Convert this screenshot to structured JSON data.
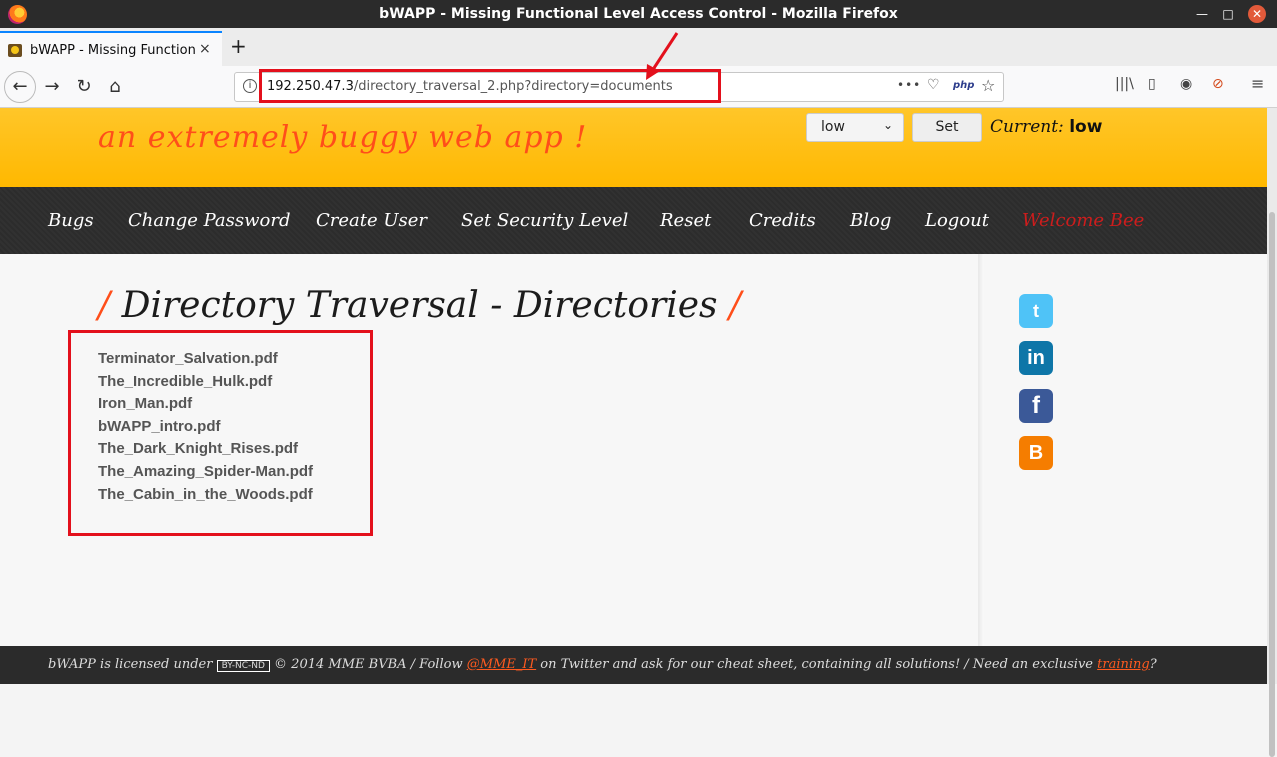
{
  "window": {
    "title": "bWAPP - Missing Functional Level Access Control - Mozilla Firefox"
  },
  "tab": {
    "title": "bWAPP - Missing Function",
    "close": "×",
    "new_tab": "+"
  },
  "nav": {
    "back": "←",
    "forward": "→",
    "reload": "↻",
    "home": "⌂"
  },
  "urlbar": {
    "info": "i",
    "host": "192.250.47.3",
    "path": "/directory_traversal_2.php?directory=documents",
    "more": "•••",
    "pocket": "♡",
    "php": "php",
    "bookmark": "☆"
  },
  "toolbar": {
    "library": "|||\\",
    "sidebar": "▯",
    "account": "◉",
    "addon": "⊘",
    "menu": "≡"
  },
  "header": {
    "tagline": "an extremely buggy web app !",
    "security_level": "low",
    "set_label": "Set",
    "current_label": "Current:",
    "current_value": "low"
  },
  "menu": {
    "items": [
      "Bugs",
      "Change Password",
      "Create User",
      "Set Security Level",
      "Reset",
      "Credits",
      "Blog",
      "Logout"
    ],
    "welcome": "Welcome Bee"
  },
  "main": {
    "slash": "/",
    "heading": "Directory Traversal - Directories",
    "files": [
      "Terminator_Salvation.pdf",
      "The_Incredible_Hulk.pdf",
      "Iron_Man.pdf",
      "bWAPP_intro.pdf",
      "The_Dark_Knight_Rises.pdf",
      "The_Amazing_Spider-Man.pdf",
      "The_Cabin_in_the_Woods.pdf"
    ]
  },
  "social": {
    "twitter": "t",
    "linkedin": "in",
    "facebook": "f",
    "blogger": "B"
  },
  "footer": {
    "part1": "bWAPP is licensed under",
    "cc": "BY-NC-ND",
    "part2": "© 2014 MME BVBA / Follow",
    "twitter_handle": "@MME_IT",
    "part3": "on Twitter and ask for our cheat sheet, containing all solutions! / Need an exclusive",
    "training": "training",
    "part4": "?"
  },
  "colors": {
    "annotation": "#e3101c",
    "accent": "#ff4e1a",
    "header": "#ffb800"
  }
}
